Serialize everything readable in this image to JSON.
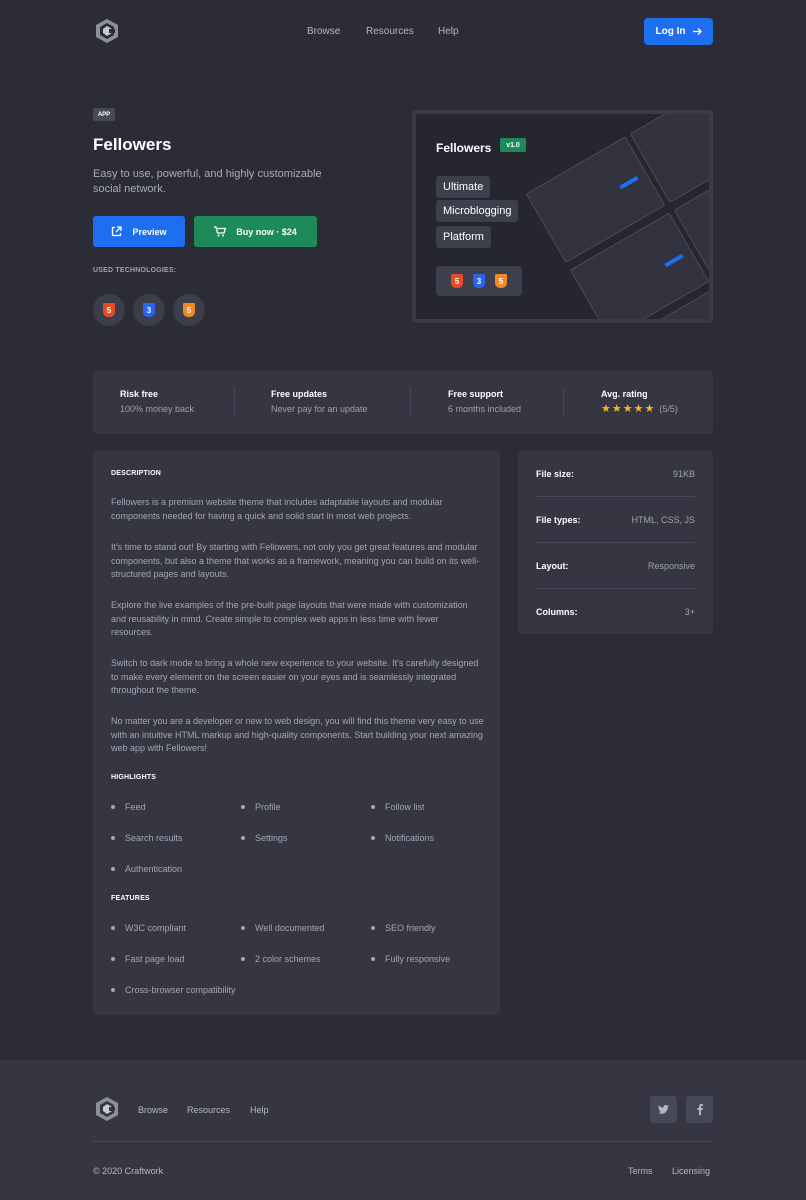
{
  "header": {
    "logo": "craftwork-logo-icon",
    "nav": [
      "Browse",
      "Resources",
      "Help"
    ],
    "login_label": "Log In"
  },
  "product": {
    "badge": "APP",
    "title": "Fellowers",
    "description": "Easy to use, powerful, and highly customizable social network.",
    "preview_label": "Preview",
    "buy_label": "Buy now",
    "price": "$24",
    "technologies_label": "USED TECHNOLOGIES:",
    "technologies": [
      {
        "icon": "html5-icon",
        "glyph": "5",
        "color": "#e34c26"
      },
      {
        "icon": "css3-icon",
        "glyph": "3",
        "color": "#2965f1"
      },
      {
        "icon": "html5-orange-icon",
        "glyph": "5",
        "color": "#f08a24"
      }
    ]
  },
  "hero": {
    "title": "Fellowers",
    "version": "v1.0",
    "tags": [
      "Ultimate",
      "Microblogging",
      "Platform"
    ]
  },
  "stats": [
    {
      "title": "Risk free",
      "subtitle": "100% money back"
    },
    {
      "title": "Free updates",
      "subtitle": "Never pay for an update"
    },
    {
      "title": "Free support",
      "subtitle": "6 months included"
    },
    {
      "title": "Avg. rating",
      "rating_value": 5,
      "rating_text": "(5/5)"
    }
  ],
  "description": {
    "heading": "DESCRIPTION",
    "paragraphs": [
      "Fellowers is a premium website theme that includes adaptable layouts and modular components needed for having a quick and solid start in most web projects.",
      "It's time to stand out! By starting with Fellowers, not only you get great features and modular components, but also a theme that works as a framework, meaning you can build on its well-structured pages and layouts.",
      "Explore the live examples of the pre-built page layouts that were made with customization and reusability in mind. Create simple to complex web apps in less time with fewer resources.",
      "Switch to dark mode to bring a whole new experience to your website. It's carefully designed to make every element on the screen easier on your eyes and is seamlessly integrated throughout the theme.",
      "No matter you are a developer or new to web design, you will find this theme very easy to use with an intuitive HTML markup and high-quality components. Start building your next amazing web app with Fellowers!"
    ],
    "highlights_heading": "HIGHLIGHTS",
    "highlights": [
      "Feed",
      "Profile",
      "Follow list",
      "Search results",
      "Settings",
      "Notifications",
      "Authentication"
    ],
    "features_heading": "FEATURES",
    "features": [
      "W3C compliant",
      "Well documented",
      "SEO friendly",
      "Fast page load",
      "2 color schemes",
      "Fully responsive",
      "Cross-browser compatibility"
    ]
  },
  "info": [
    {
      "key": "File size:",
      "value": "91KB"
    },
    {
      "key": "File types:",
      "value": "HTML, CSS, JS"
    },
    {
      "key": "Layout:",
      "value": "Responsive"
    },
    {
      "key": "Columns:",
      "value": "3+"
    }
  ],
  "footer": {
    "nav": [
      "Browse",
      "Resources",
      "Help"
    ],
    "social": [
      "twitter-icon",
      "facebook-icon"
    ],
    "copyright": "© 2020 Craftwork",
    "links": [
      "Terms",
      "Licensing"
    ]
  },
  "colors": {
    "background": "#2b2c36",
    "card": "#353642",
    "primary": "#1e6ff0",
    "success": "#1d8a5a",
    "star": "#f7b32b"
  }
}
